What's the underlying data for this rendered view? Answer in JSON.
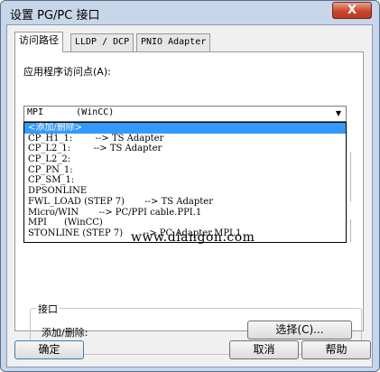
{
  "window": {
    "title": "设置 PG/PC 接口",
    "close_label": "X"
  },
  "tabs": [
    {
      "label": "访问路径"
    },
    {
      "label": "LLDP / DCP"
    },
    {
      "label": "PNIO Adapter"
    }
  ],
  "access_point": {
    "label": "应用程序访问点(A):",
    "selected": "MPI      (WinCC)",
    "options": [
      "<添加/删除>",
      "CP_H1_1:        --> TS Adapter",
      "CP_L2_1:        --> TS Adapter",
      "CP_L2_2:",
      "CP_PN_1:",
      "CP_SM_1:",
      "DPSONLINE",
      "FWL_LOAD (STEP 7)       --> TS Adapter",
      "Micro/WIN       --> PC/PPI cable.PPI.1",
      "MPI      (WinCC)",
      "STONLINE (STEP 7)       --> PC Adapter.MPI.1"
    ]
  },
  "watermark": "www.diangon.com",
  "interface_group": {
    "title": "接口",
    "add_remove_label": "添加/删除:",
    "select_button": "选择(C)..."
  },
  "footer": {
    "ok": "确定",
    "cancel": "取消",
    "help": "帮助"
  },
  "colors": {
    "selection": "#3399ff",
    "frame": "#c7d6e8",
    "close": "#c9472c"
  }
}
